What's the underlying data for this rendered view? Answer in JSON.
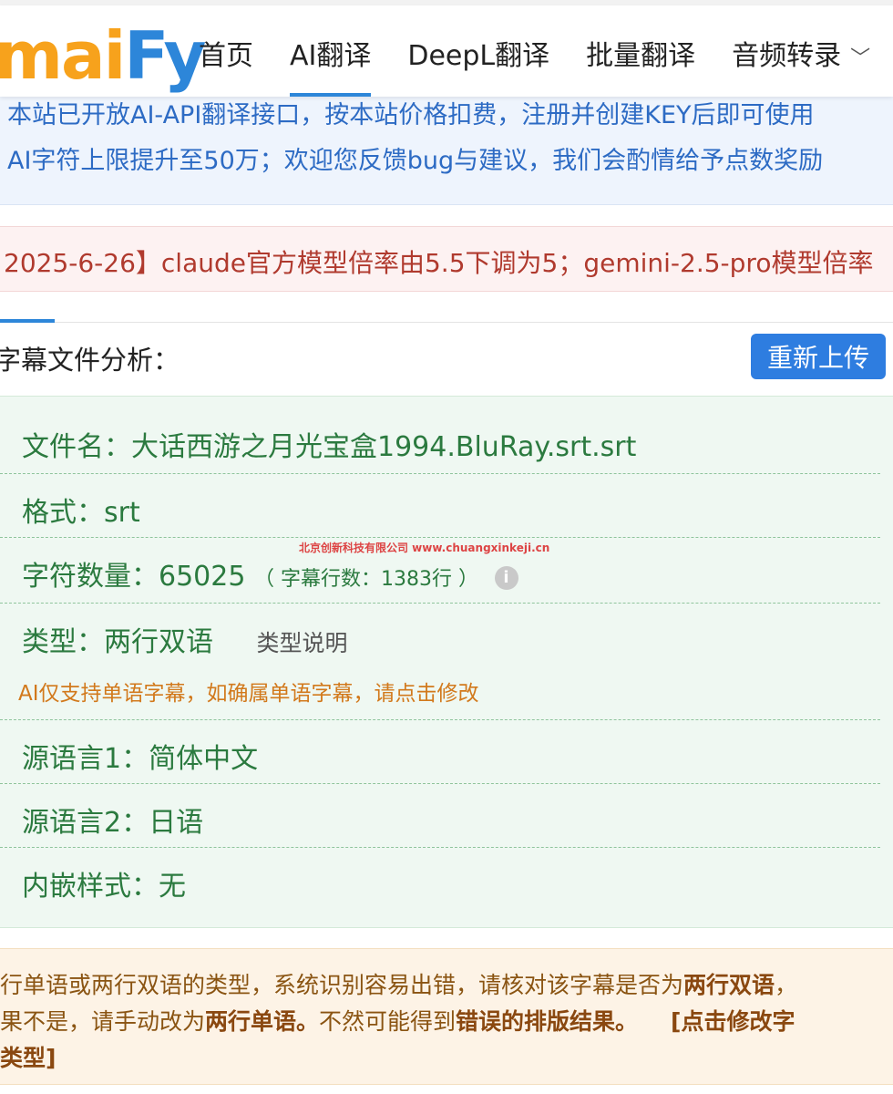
{
  "logo": {
    "part1": "mai",
    "part2": "Fy"
  },
  "nav": {
    "home": "首页",
    "ai_translate": "AI翻译",
    "deepl_translate": "DeepL翻译",
    "batch_translate": "批量翻译",
    "audio_transcribe": "音频转录"
  },
  "notices": {
    "blue_line1": "本站已开放AI-API翻译接口，按本站价格扣费，注册并创建KEY后即可使用",
    "blue_line2": "AI字符上限提升至50万；欢迎您反馈bug与建议，我们会酌情给予点数奖励",
    "red_line": "2025-6-26】claude官方模型倍率由5.5下调为5；gemini-2.5-pro模型倍率"
  },
  "section": {
    "title": "字幕文件分析：",
    "reupload_label": "重新上传"
  },
  "file_info": {
    "filename": "文件名：大话西游之月光宝盒1994.BluRay.srt.srt",
    "format": "格式：srt",
    "char_count": "字符数量：65025",
    "line_count": "（ 字幕行数：1383行 ）",
    "type": "类型：两行双语",
    "type_desc": "类型说明",
    "ai_note": "AI仅支持单语字幕，如确属单语字幕，请点击修改",
    "source_lang1": "源语言1：简体中文",
    "source_lang2": "源语言2：日语",
    "embedded_style": "内嵌样式：无"
  },
  "watermark": "北京创新科技有限公司 www.chuangxinkeji.cn",
  "warning": {
    "line1_a": "行单语或两行双语的类型，系统识别容易出错，请核对该字幕是否为",
    "line1_b": "两行双语",
    "line1_c": "，",
    "line2_a": "果不是，请手动改为",
    "line2_b": "两行单语。",
    "line2_c": "不然可能得到",
    "line2_d": "错误的排版结果。",
    "line2_e": "[点击修改字",
    "line3": "类型]"
  },
  "colors": {
    "accent": "#2d86d9",
    "logo_orange": "#f7a21c",
    "success_text": "#2b7a3f",
    "danger_text": "#b03a2e",
    "warning_text": "#8a5412"
  }
}
